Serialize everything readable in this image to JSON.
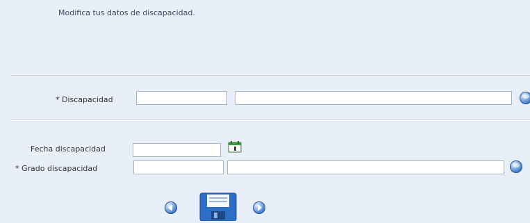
{
  "intro_text": "Modifica tus datos de discapacidad.",
  "discapacidad": {
    "label": "* Discapacidad",
    "code_value": "",
    "description_value": ""
  },
  "fecha": {
    "label": "Fecha discapacidad",
    "value": ""
  },
  "grado": {
    "label": "* Grado discapacidad",
    "code_value": "",
    "description_value": ""
  },
  "icons": {
    "discapacidad_lookup": "search-orb-icon",
    "calendar": "calendar-icon",
    "grado_lookup": "search-orb-icon",
    "prev": "arrow-left-icon",
    "save": "floppy-disk-icon",
    "next": "arrow-right-icon"
  },
  "colors": {
    "background": "#e8eff8",
    "accent": "#2f6fbe"
  }
}
